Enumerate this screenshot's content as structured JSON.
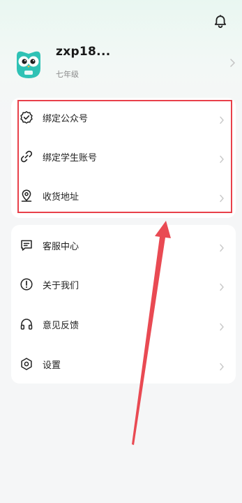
{
  "profile": {
    "username": "zxp18...",
    "grade": "七年级"
  },
  "menu_group_1": [
    {
      "label": "绑定公众号",
      "icon": "badge-check-icon"
    },
    {
      "label": "绑定学生账号",
      "icon": "link-icon"
    },
    {
      "label": "收货地址",
      "icon": "location-pin-icon"
    }
  ],
  "menu_group_2": [
    {
      "label": "客服中心",
      "icon": "chat-icon"
    },
    {
      "label": "关于我们",
      "icon": "info-icon"
    },
    {
      "label": "意见反馈",
      "icon": "headphones-icon"
    },
    {
      "label": "设置",
      "icon": "settings-icon"
    }
  ],
  "colors": {
    "highlight": "#e8404a",
    "arrow": "#e8404a",
    "avatar": "#2fc2b5",
    "background": "#f5f6f7"
  }
}
